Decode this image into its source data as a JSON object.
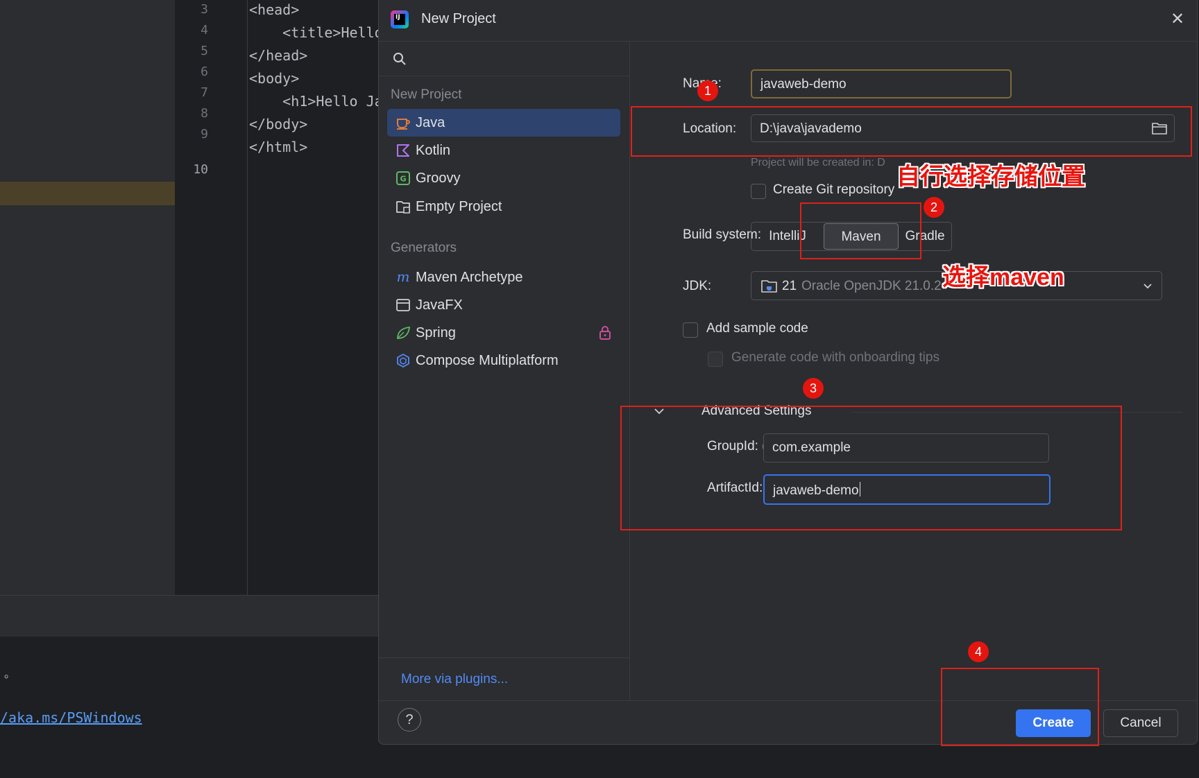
{
  "editor": {
    "line_numbers": [
      "3",
      "4",
      "5",
      "6",
      "7",
      "8",
      "9",
      "10"
    ],
    "code_lines": [
      "<head>",
      "    <title>Hello",
      "</head>",
      "<body>",
      "    <h1>Hello Ja",
      "</body>",
      "</html>",
      ""
    ],
    "terminal_dot": "。",
    "terminal_link": "/aka.ms/PSWindows"
  },
  "dialog": {
    "title": "New Project",
    "app_icon": "intellij-logo-icon",
    "close_icon": "close-icon"
  },
  "sidebar": {
    "search_icon": "search-icon",
    "sections": [
      {
        "heading": "New Project",
        "items": [
          {
            "label": "Java",
            "icon": "java-cup-icon",
            "selected": true
          },
          {
            "label": "Kotlin",
            "icon": "kotlin-icon"
          },
          {
            "label": "Groovy",
            "icon": "groovy-icon"
          },
          {
            "label": "Empty Project",
            "icon": "empty-project-folder-icon"
          }
        ]
      },
      {
        "heading": "Generators",
        "items": [
          {
            "label": "Maven Archetype",
            "icon": "maven-icon"
          },
          {
            "label": "JavaFX",
            "icon": "window-icon"
          },
          {
            "label": "Spring",
            "icon": "spring-leaf-icon",
            "locked": true
          },
          {
            "label": "Compose Multiplatform",
            "icon": "compose-icon"
          }
        ]
      }
    ],
    "more_plugins": "More via plugins..."
  },
  "form": {
    "name_label": "Name:",
    "name_value": "javaweb-demo",
    "location_label": "Location:",
    "location_value": "D:\\java\\javademo",
    "location_hint": "Project will be created in: D",
    "create_git_label": "Create Git repository",
    "create_git_checked": false,
    "build_system_label": "Build system:",
    "build_options": [
      "IntelliJ",
      "Maven",
      "Gradle"
    ],
    "build_selected": "Maven",
    "jdk_label": "JDK:",
    "jdk_version": "21",
    "jdk_name": "Oracle OpenJDK 21.0.2",
    "add_sample_label": "Add sample code",
    "add_sample_checked": false,
    "onboarding_label": "Generate code with onboarding tips",
    "onboarding_checked": false,
    "advanced_label": "Advanced Settings",
    "group_label": "GroupId:",
    "group_value": "com.example",
    "artifact_label": "ArtifactId:",
    "artifact_value": "javaweb-demo"
  },
  "footer": {
    "help_label": "?",
    "create_label": "Create",
    "cancel_label": "Cancel"
  },
  "annotations": {
    "badges": [
      "1",
      "2",
      "3",
      "4"
    ],
    "location_note": "自行选择存储位置",
    "maven_note": "选择maven",
    "color": "#e0201b"
  }
}
